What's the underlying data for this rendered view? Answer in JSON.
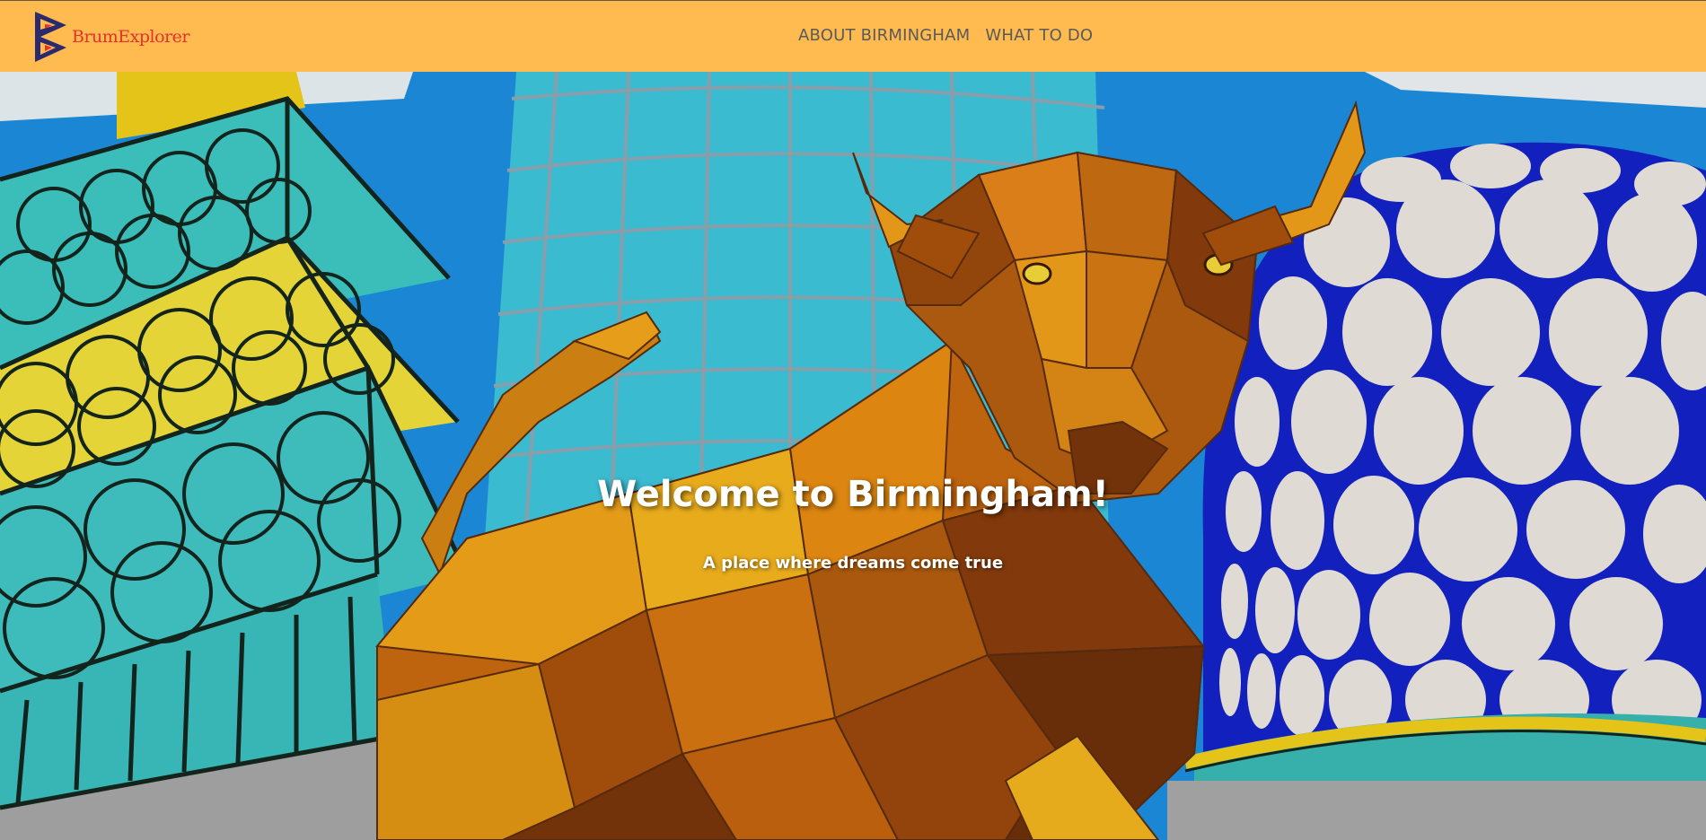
{
  "navbar": {
    "brand": {
      "text": "BrumExplorer",
      "logo_icon": "letter-b-triangle-logo",
      "text_color": "#e5322d",
      "logo_color": "#2b2a6e"
    },
    "background_color": "#ffbb4f",
    "links": [
      {
        "label": "ABOUT BIRMINGHAM"
      },
      {
        "label": "WHAT TO DO"
      }
    ]
  },
  "hero": {
    "title": "Welcome to Birmingham!",
    "subtitle": "A place where dreams come true",
    "image": "geometric-bull-mural"
  }
}
